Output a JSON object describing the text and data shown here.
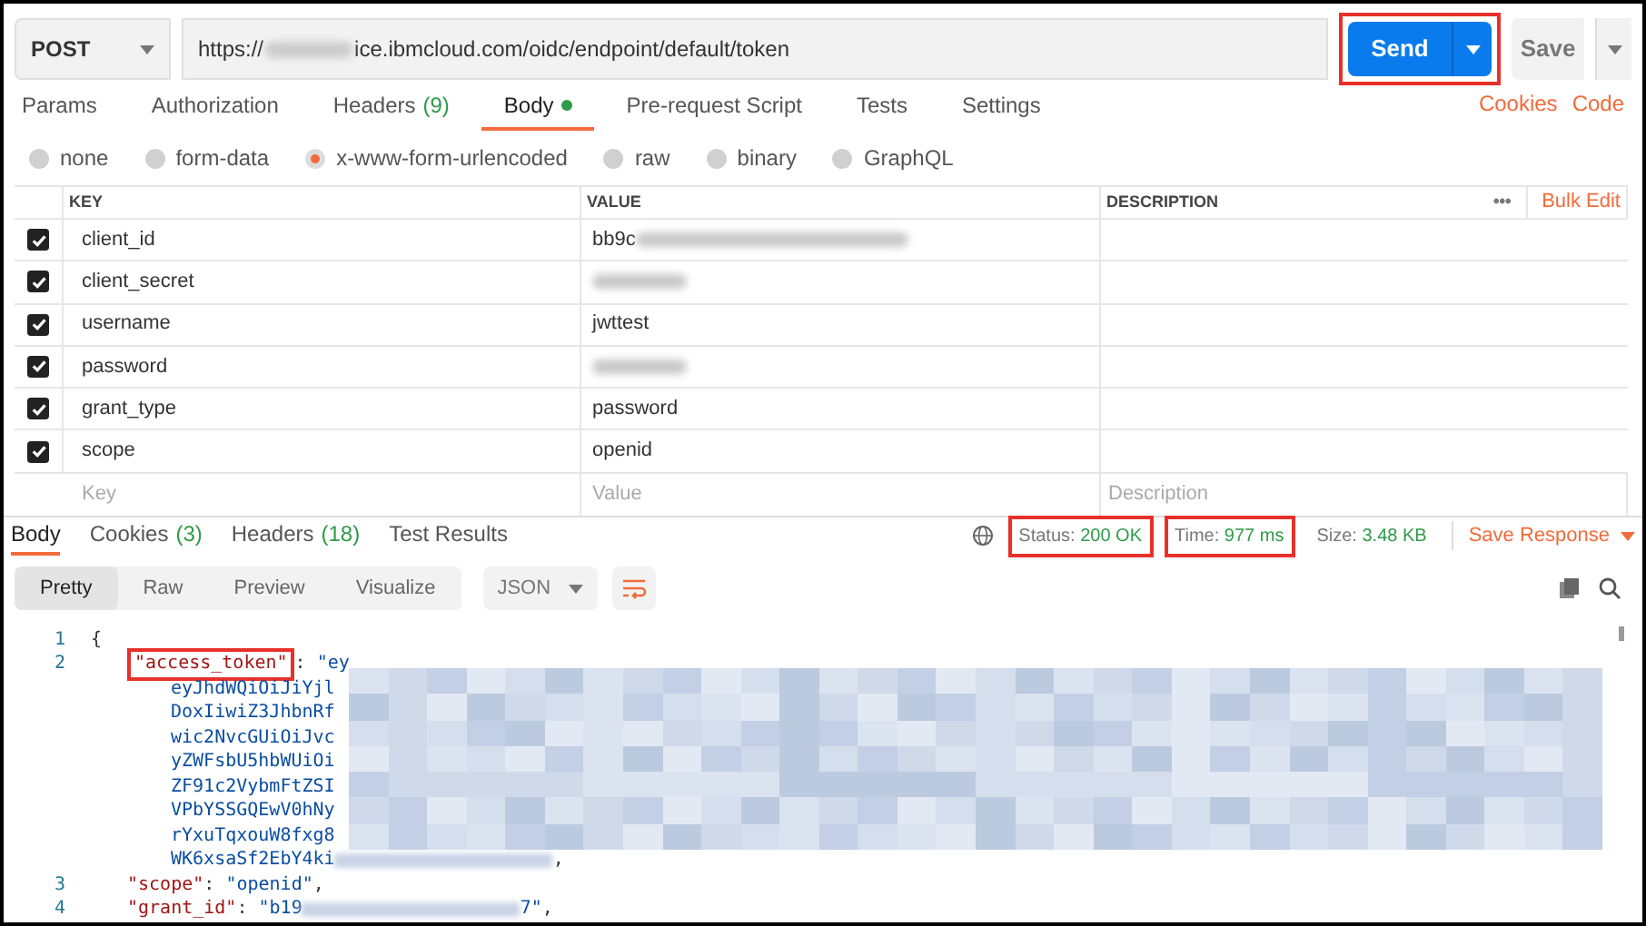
{
  "request": {
    "method": "POST",
    "url_start": "https://",
    "url_end": "ice.ibmcloud.com/oidc/endpoint/default/token",
    "send": "Send",
    "save": "Save",
    "send_highlighted": true
  },
  "request_tabs": [
    {
      "label": "Params",
      "selected": false
    },
    {
      "label": "Authorization",
      "selected": false
    },
    {
      "label": "Headers",
      "count": "(9)",
      "selected": false
    },
    {
      "label": "Body",
      "dot": true,
      "selected": true
    },
    {
      "label": "Pre-request Script",
      "selected": false
    },
    {
      "label": "Tests",
      "selected": false
    },
    {
      "label": "Settings",
      "selected": false
    }
  ],
  "links": [
    "Cookies",
    "Code"
  ],
  "body_types": [
    {
      "label": "none",
      "selected": false
    },
    {
      "label": "form-data",
      "selected": false
    },
    {
      "label": "x-www-form-urlencoded",
      "selected": true
    },
    {
      "label": "raw",
      "selected": false
    },
    {
      "label": "binary",
      "selected": false
    },
    {
      "label": "GraphQL",
      "selected": false
    }
  ],
  "params_table": {
    "columns": [
      "KEY",
      "VALUE",
      "DESCRIPTION"
    ],
    "more": "•••",
    "bulk_edit": "Bulk Edit",
    "rows": [
      {
        "checked": true,
        "key": "client_id",
        "value": "bb9c",
        "redacted": true
      },
      {
        "checked": true,
        "key": "client_secret",
        "redacted": true
      },
      {
        "checked": true,
        "key": "username",
        "value": "jwttest"
      },
      {
        "checked": true,
        "key": "password",
        "redacted": true
      },
      {
        "checked": true,
        "key": "grant_type",
        "value": "password"
      },
      {
        "checked": true,
        "key": "scope",
        "value": "openid"
      }
    ],
    "new_row": {
      "key": "Key",
      "value": "Value",
      "description": "Description"
    }
  },
  "response": {
    "tabs": [
      {
        "label": "Body",
        "selected": true
      },
      {
        "label": "Cookies",
        "count": "(3)",
        "selected": false
      },
      {
        "label": "Headers",
        "count": "(18)",
        "selected": false
      },
      {
        "label": "Test Results",
        "selected": false
      }
    ],
    "status": {
      "label": "Status:",
      "value": "200 OK",
      "highlighted": true
    },
    "time": {
      "label": "Time:",
      "value": "977 ms",
      "highlighted": true
    },
    "size": {
      "label": "Size:",
      "value": "3.48 KB",
      "highlighted": false
    },
    "save_response": "Save Response",
    "view_modes": [
      {
        "label": "Pretty",
        "selected": true
      },
      {
        "label": "Raw",
        "selected": false
      },
      {
        "label": "Preview",
        "selected": false
      },
      {
        "label": "Visualize",
        "selected": false
      }
    ],
    "format": "JSON",
    "pixelated": true,
    "lines": [
      {
        "number": "1",
        "parts": [
          {
            "text": "{",
            "kind": "punct"
          }
        ]
      },
      {
        "number": "2",
        "parts": [
          {
            "text": "\"access_token\"",
            "kind": "key",
            "highlighted": true
          },
          {
            "text": ": ",
            "kind": "punct"
          },
          {
            "text": "\"ey",
            "kind": "string"
          }
        ]
      },
      {
        "parts": [
          {
            "text": "eyJhdWQiOiJiYjl",
            "kind": "string"
          }
        ]
      },
      {
        "parts": [
          {
            "text": "DoxIiwiZ3JhbnRf",
            "kind": "string"
          }
        ]
      },
      {
        "parts": [
          {
            "text": "wic2NvcGUiOiJvc",
            "kind": "string"
          }
        ]
      },
      {
        "parts": [
          {
            "text": "yZWFsbU5hbWUiOi",
            "kind": "string"
          }
        ]
      },
      {
        "parts": [
          {
            "text": "ZF91c2VybmFtZSI",
            "kind": "string"
          }
        ]
      },
      {
        "parts": [
          {
            "text": "VPbYSSGQEwV0hNy",
            "kind": "string"
          }
        ]
      },
      {
        "parts": [
          {
            "text": "rYxuTqxouW8fxg8",
            "kind": "string"
          }
        ]
      },
      {
        "parts": [
          {
            "text": "WK6xsaSf2EbY4ki",
            "kind": "string"
          },
          {
            "kind": "redacted"
          },
          {
            "text": ",",
            "kind": "punct"
          }
        ]
      },
      {
        "number": "3",
        "parts": [
          {
            "text": "\"scope\"",
            "kind": "key"
          },
          {
            "text": ": ",
            "kind": "punct"
          },
          {
            "text": "\"openid\"",
            "kind": "string"
          },
          {
            "text": ",",
            "kind": "punct"
          }
        ]
      },
      {
        "number": "4",
        "parts": [
          {
            "text": "\"grant_id\"",
            "kind": "key"
          },
          {
            "text": ": ",
            "kind": "punct"
          },
          {
            "text": "\"b19",
            "kind": "string"
          },
          {
            "kind": "redacted"
          },
          {
            "text": "7\"",
            "kind": "string"
          },
          {
            "text": ",",
            "kind": "punct"
          }
        ]
      }
    ]
  }
}
